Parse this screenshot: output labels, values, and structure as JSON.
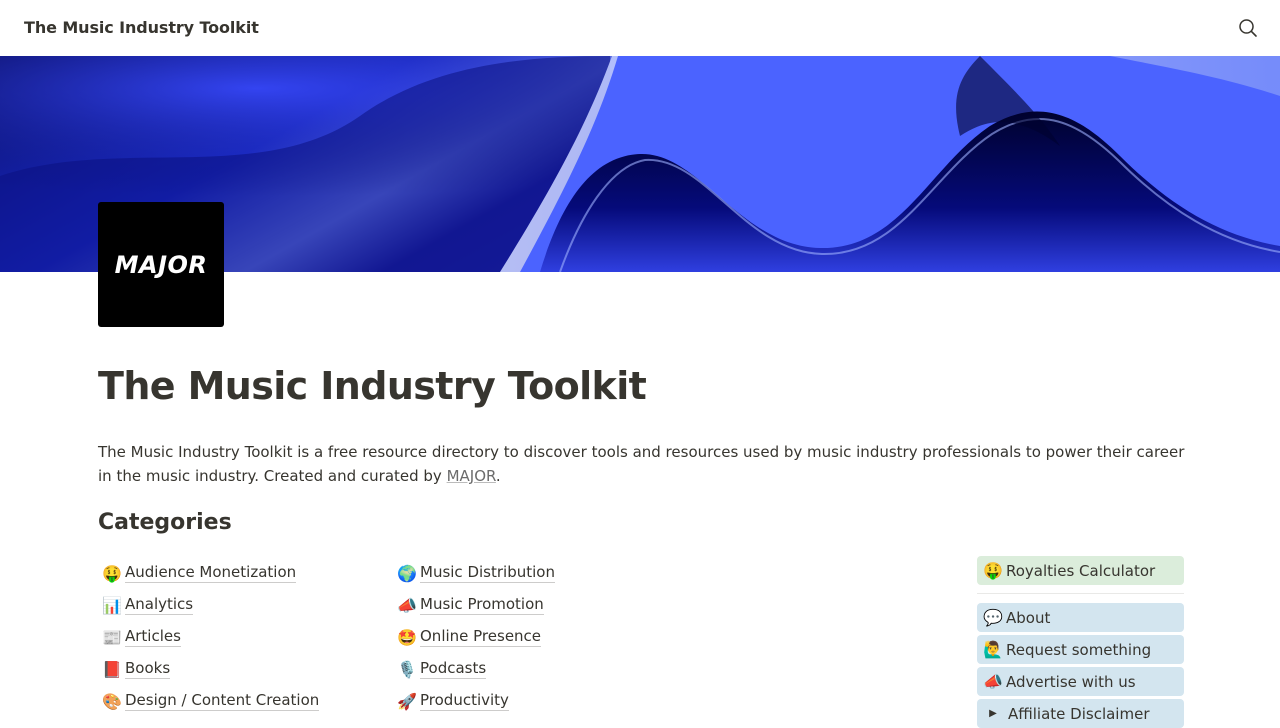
{
  "header": {
    "site_title": "The Music Industry Toolkit",
    "search_icon": "search-icon"
  },
  "cover": {
    "colors": [
      "#0a0f5c",
      "#2a3ae0",
      "#7a9cff",
      "#00022e",
      "#b9c4ff"
    ]
  },
  "logo": {
    "text": "MAJOR",
    "background": "#000000"
  },
  "page": {
    "title": "The Music Industry Toolkit",
    "intro_text": "The Music Industry Toolkit is a free resource directory to discover tools and resources used by music industry professionals to power their career in the music industry. Created and curated by ",
    "intro_link": "MAJOR",
    "intro_end": "."
  },
  "categories": {
    "heading": "Categories",
    "left": [
      {
        "emoji": "🤑",
        "label": "Audience Monetization"
      },
      {
        "emoji": "📊",
        "label": "Analytics"
      },
      {
        "emoji": "📰",
        "label": "Articles"
      },
      {
        "emoji": "📕",
        "label": "Books"
      },
      {
        "emoji": "🎨",
        "label": "Design / Content Creation"
      }
    ],
    "right": [
      {
        "emoji": "🌍",
        "label": "Music Distribution"
      },
      {
        "emoji": "📣",
        "label": "Music Promotion"
      },
      {
        "emoji": "🤩",
        "label": "Online Presence"
      },
      {
        "emoji": "🎙️",
        "label": "Podcasts"
      },
      {
        "emoji": "🚀",
        "label": "Productivity"
      }
    ]
  },
  "sidebar": {
    "highlight": {
      "emoji": "🤑",
      "label": "Royalties Calculator",
      "color": "#dbeddb"
    },
    "links": [
      {
        "emoji": "💬",
        "label": "About"
      },
      {
        "emoji": "🙋‍♂️",
        "label": "Request something"
      },
      {
        "emoji": "📣",
        "label": "Advertise with us"
      }
    ],
    "toggle": {
      "label": "Affiliate Disclaimer"
    },
    "link_color": "#d3e5ef"
  }
}
